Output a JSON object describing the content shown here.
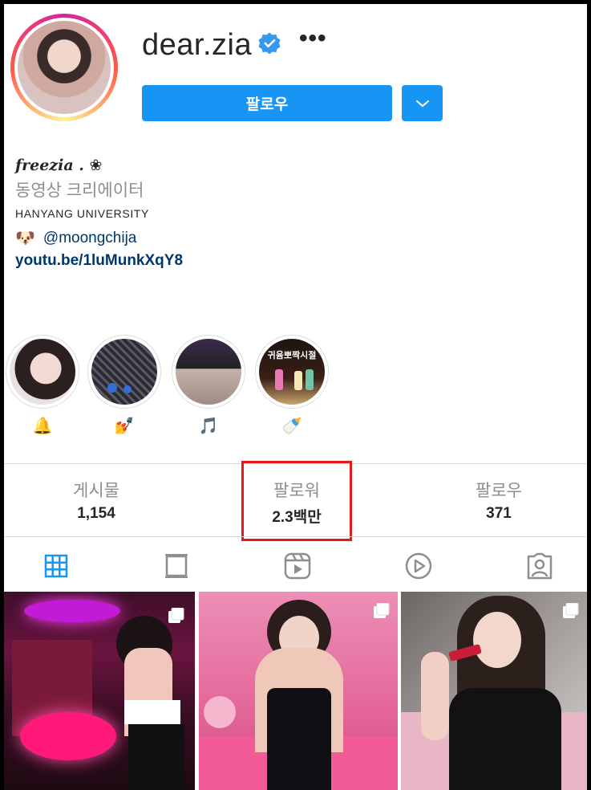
{
  "profile": {
    "username": "dear.zia",
    "follow_label": "팔로우",
    "bio": {
      "name": "freezia .",
      "name_emoji": "❀",
      "category": "동영상 크리에이터",
      "school": "HANYANG UNIVERSITY",
      "mention_emoji": "🐶",
      "mention": "@moongchija",
      "link": "youtu.be/1luMunkXqY8"
    }
  },
  "highlights": [
    {
      "emoji": "🔔"
    },
    {
      "emoji": "💅"
    },
    {
      "emoji": "🎵"
    },
    {
      "emoji": "🍼",
      "cover_text": "귀윰뽀짝시절"
    }
  ],
  "stats": [
    {
      "label": "게시물",
      "value": "1,154"
    },
    {
      "label": "팔로워",
      "value": "2.3백만"
    },
    {
      "label": "팔로우",
      "value": "371"
    }
  ],
  "colors": {
    "accent": "#1795f5",
    "highlight_box": "#e11a1a",
    "link": "#00376b"
  },
  "tabs": [
    "grid-icon",
    "feed-icon",
    "reels-icon",
    "video-icon",
    "tagged-icon"
  ]
}
